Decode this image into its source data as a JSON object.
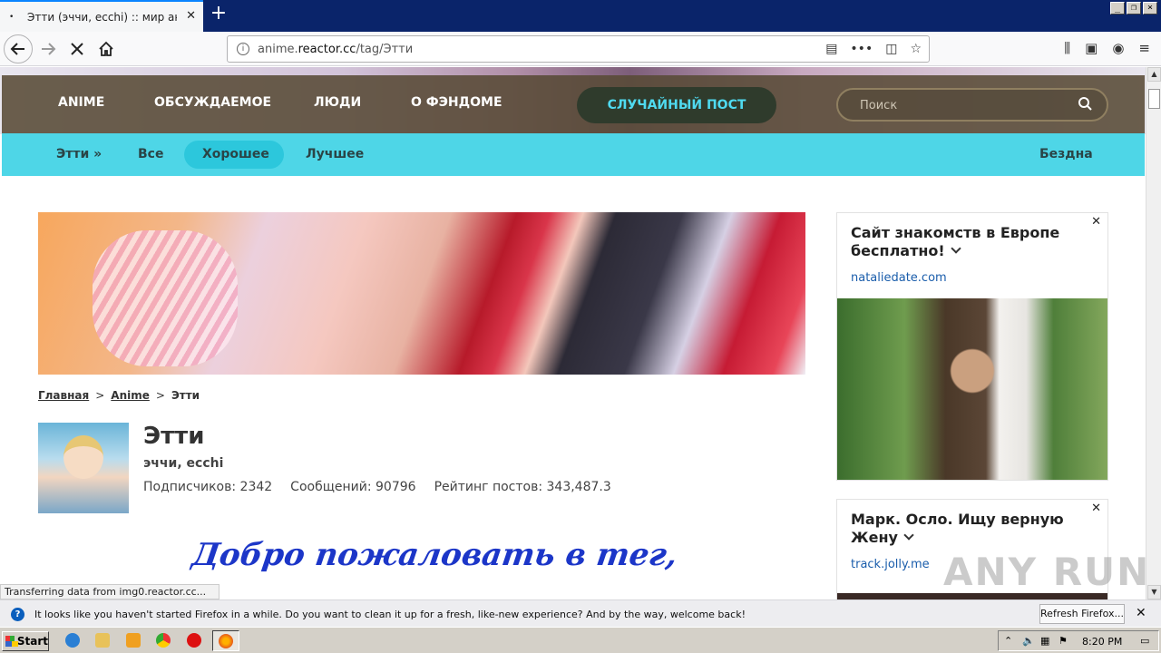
{
  "browser": {
    "tab_title": "Этти (эччи, ecchi) :: мир аниме /",
    "tab_dot": "•",
    "tab_close": "✕",
    "new_tab": "+",
    "url_plain": "anime.",
    "url_host": "reactor.cc",
    "url_path": "/tag/Этти",
    "url_more": "•••"
  },
  "site_nav": {
    "items": [
      "ANIME",
      "ОБСУЖДАЕМОЕ",
      "ЛЮДИ",
      "О ФЭНДОМЕ"
    ],
    "random_post": "СЛУЧАЙНЫЙ ПОСТ",
    "search_placeholder": "Поиск"
  },
  "sub_nav": {
    "tag_link": "Этти »",
    "all": "Все",
    "good": "Хорошее",
    "best": "Лучшее",
    "abyss": "Бездна"
  },
  "breadcrumb": {
    "home": "Главная",
    "sep": ">",
    "section": "Anime",
    "current": "Этти"
  },
  "tag": {
    "title": "Этти",
    "aliases": "эччи, ecchi",
    "subscribers": "Подписчиков: 2342",
    "messages": "Сообщений: 90796",
    "rating": "Рейтинг постов: 343,487.3",
    "welcome_text": "Добро пожаловать в тег,"
  },
  "ads": [
    {
      "title": "Сайт знакомств в Европе бесплатно!",
      "domain": "nataliedate.com",
      "close": "✕"
    },
    {
      "title": "Марк. Осло. Ищу верную Жену",
      "domain": "track.jolly.me",
      "close": "✕"
    }
  ],
  "status_bar": "Transferring data from img0.reactor.cc...",
  "watermark": "ANY RUN",
  "notification": {
    "message": "It looks like you haven't started Firefox in a while. Do you want to clean it up for a fresh, like-new experience? And by the way, welcome back!",
    "button": "Refresh Firefox...",
    "close": "✕"
  },
  "taskbar": {
    "start": "Start",
    "clock": "8:20 PM"
  }
}
